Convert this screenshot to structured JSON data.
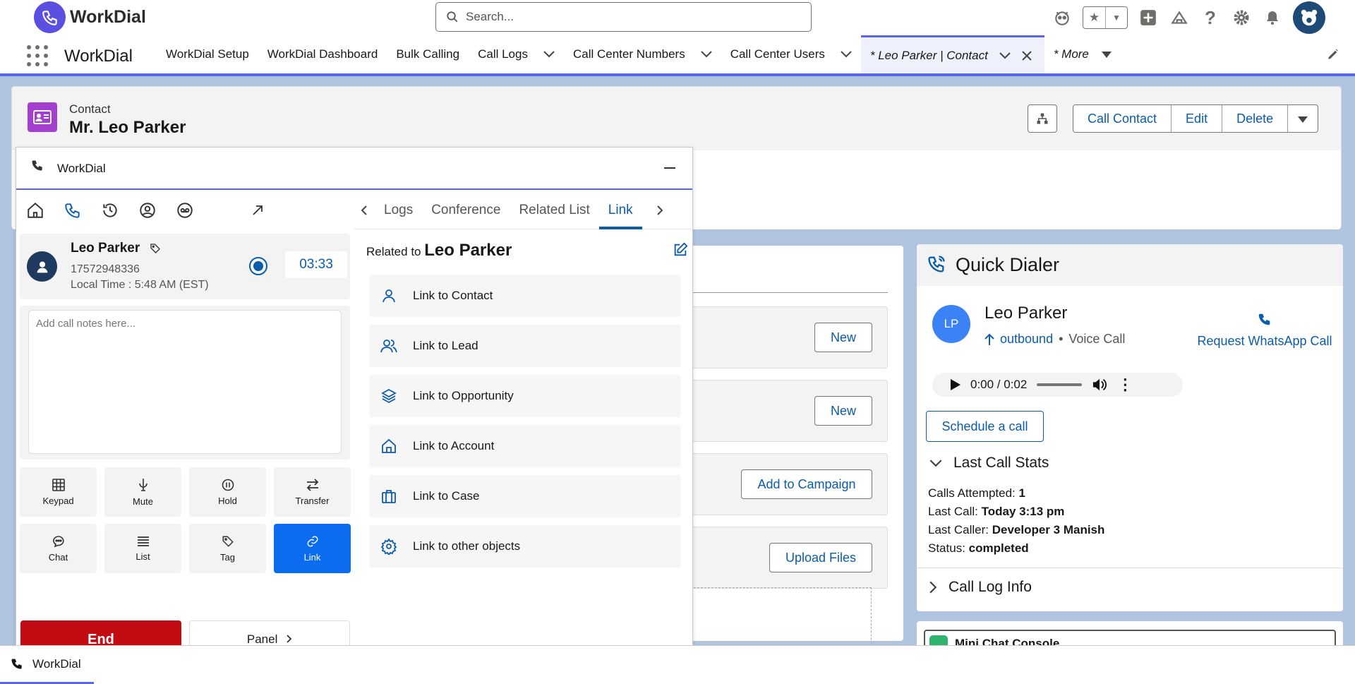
{
  "header": {
    "logo_text": "WorkDial",
    "search_placeholder": "Search..."
  },
  "nav": {
    "app_name": "WorkDial",
    "items": [
      {
        "label": "WorkDial Setup"
      },
      {
        "label": "WorkDial Dashboard"
      },
      {
        "label": "Bulk Calling"
      },
      {
        "label": "Call Logs"
      },
      {
        "label": "Call Center Numbers"
      },
      {
        "label": "Call Center Users"
      },
      {
        "label": "* Leo Parker | Contact"
      },
      {
        "label": "* More"
      }
    ]
  },
  "record": {
    "type": "Contact",
    "name": "Mr. Leo Parker",
    "actions": [
      "Call Contact",
      "Edit",
      "Delete"
    ]
  },
  "related": {
    "new_1": "New",
    "new_2": "New",
    "add_campaign": "Add to Campaign",
    "upload_files": "Upload Files"
  },
  "quick_dialer": {
    "title": "Quick Dialer",
    "initials": "LP",
    "name": "Leo Parker",
    "direction": "outbound",
    "separator": "•",
    "call_type": "Voice Call",
    "whatsapp": "Request WhatsApp Call",
    "audio_time": "0:00 / 0:02",
    "schedule": "Schedule a call",
    "stats_title": "Last Call Stats",
    "stats": {
      "attempted_label": "Calls Attempted:",
      "attempted": "1",
      "last_call_label": "Last Call:",
      "last_call": "Today 3:13 pm",
      "last_caller_label": "Last Caller:",
      "last_caller": "Developer 3 Manish",
      "status_label": "Status:",
      "status": "completed"
    },
    "call_log_info": "Call Log Info"
  },
  "mini_chat": {
    "title": "Mini Chat Console"
  },
  "softphone": {
    "title": "WorkDial",
    "caller_name": "Leo Parker",
    "caller_number": "17572948336",
    "local_time": "Local Time : 5:48 AM (EST)",
    "timer": "03:33",
    "notes_placeholder": "Add call notes here...",
    "controls": [
      "Keypad",
      "Mute",
      "Hold",
      "Transfer",
      "Chat",
      "List",
      "Tag",
      "Link"
    ],
    "end_label": "End",
    "panel_label": "Panel",
    "tabs": [
      "Logs",
      "Conference",
      "Related List",
      "Link"
    ],
    "related_prefix": "Related to",
    "related_name": "Leo Parker",
    "links": [
      {
        "label": "Link to Contact",
        "icon": "person-icon"
      },
      {
        "label": "Link to Lead",
        "icon": "people-icon"
      },
      {
        "label": "Link to Opportunity",
        "icon": "layers-icon"
      },
      {
        "label": "Link to Account",
        "icon": "building-icon"
      },
      {
        "label": "Link to Case",
        "icon": "briefcase-icon"
      },
      {
        "label": "Link to other objects",
        "icon": "gear-icon"
      }
    ]
  },
  "utility": {
    "label": "WorkDial"
  }
}
